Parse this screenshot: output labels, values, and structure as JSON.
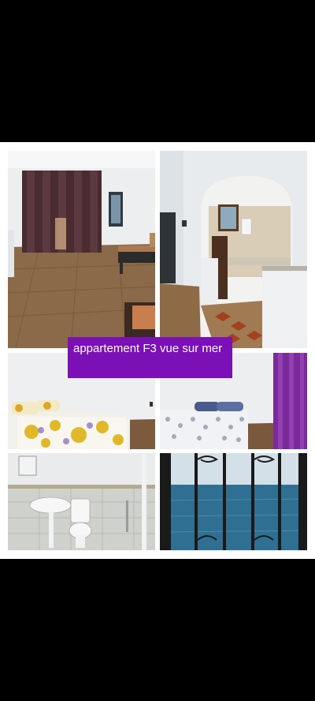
{
  "listing": {
    "caption": "appartement F3 vue sur mer"
  },
  "photos": [
    {
      "name": "living-room-photo",
      "subject": "living room"
    },
    {
      "name": "kitchen-photo",
      "subject": "kitchen with archway"
    },
    {
      "name": "bedroom-photo-1",
      "subject": "bedroom with floral bedspread"
    },
    {
      "name": "bedroom-photo-2",
      "subject": "bedroom with purple curtain"
    },
    {
      "name": "bathroom-photo",
      "subject": "bathroom"
    },
    {
      "name": "sea-view-photo",
      "subject": "sea view through window grille"
    }
  ],
  "colors": {
    "banner": "#7b10b6",
    "banner_text": "#ffffff",
    "frame": "#ffffff",
    "background": "#000000"
  }
}
